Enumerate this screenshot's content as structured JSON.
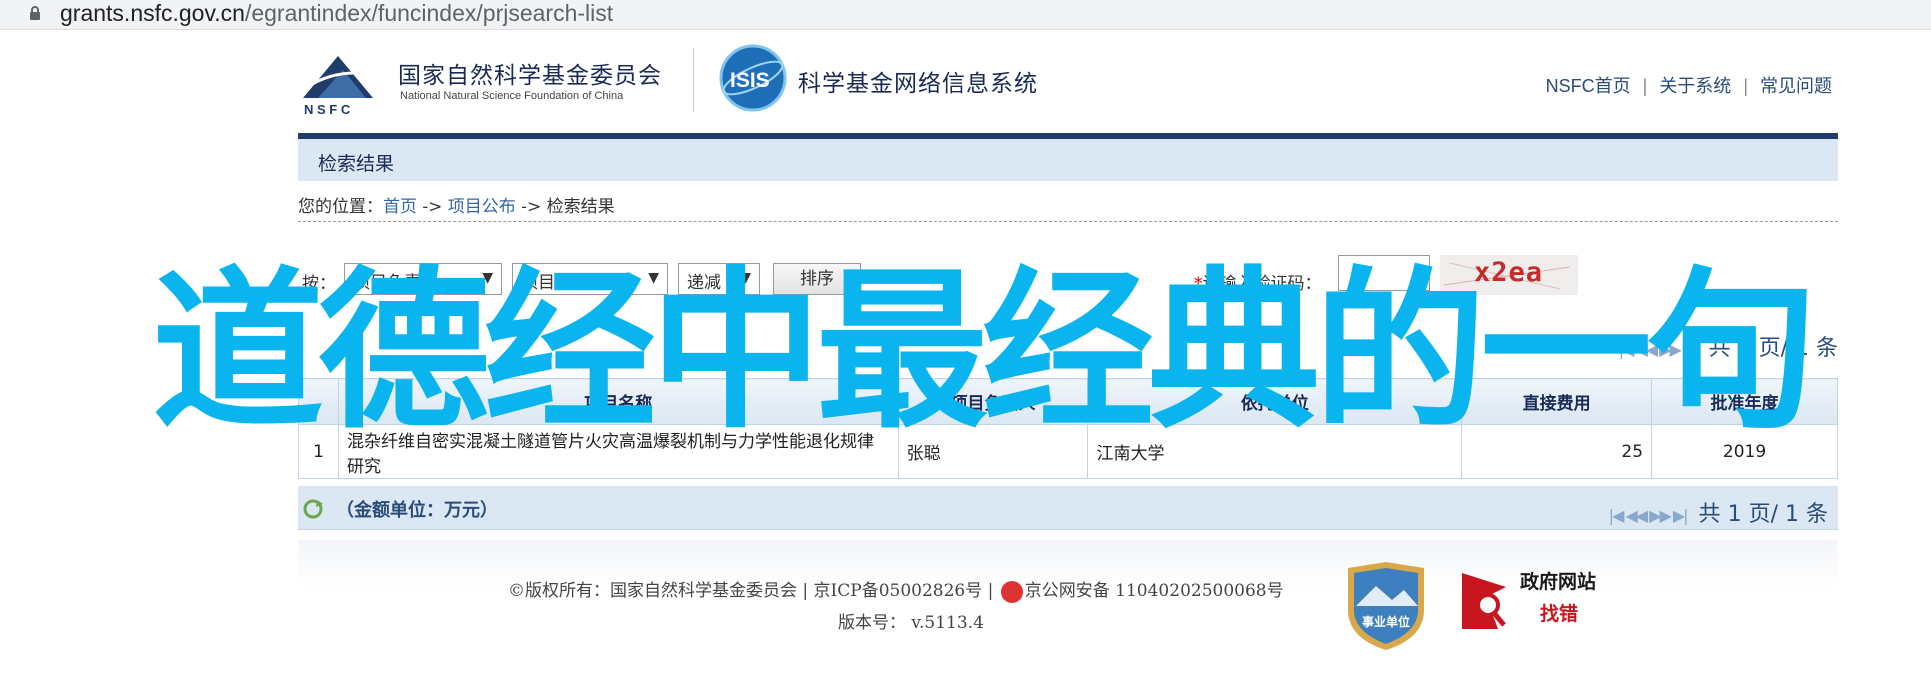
{
  "browser": {
    "url_host": "grants.nsfc.gov.cn",
    "url_path": "/egrantindex/funcindex/prjsearch-list"
  },
  "header": {
    "org_cn": "国家自然科学基金委员会",
    "org_en": "National Natural Science Foundation of China",
    "logo_text": "N S F C",
    "isis_text": "ISIS",
    "system_title": "科学基金网络信息系统",
    "nav": [
      "NSFC首页",
      "关于系统",
      "常见问题"
    ],
    "nav_sep": "|"
  },
  "section_title": "检索结果",
  "breadcrumb": {
    "prefix": "您的位置：",
    "items": [
      "首页",
      "项目公布",
      "检索结果"
    ],
    "sep": " -> "
  },
  "sort": {
    "label": "按：",
    "field1": "项目负责人",
    "field2": "项目名称",
    "order": "递减",
    "sort_button": "排序",
    "captcha_label": "请输入验证码：",
    "required_mark": "*",
    "captcha_text": "x2ea"
  },
  "pager": {
    "prefix": "共",
    "current": "1",
    "unit": "页/",
    "total": "1",
    "total_unit": "条"
  },
  "table": {
    "columns": [
      "",
      "项目名称",
      "项目负责人",
      "依托单位",
      "直接费用",
      "批准年度"
    ],
    "rows": [
      {
        "index": "1",
        "title": "混杂纤维自密实混凝土隧道管片火灾高温爆裂机制与力学性能退化规律研究",
        "leader": "张聪",
        "unit": "江南大学",
        "cost": "25",
        "year": "2019"
      }
    ]
  },
  "summary_label": "（金额单位：万元）",
  "footer": {
    "copyright": "©版权所有：国家自然科学基金委员会 | 京ICP备05002826号 | ",
    "police": "京公网安备 11040202500068号",
    "version_label": "版本号：",
    "version": "v.5113.4",
    "shield_text": "事业单位",
    "gov_line1": "政府网站",
    "gov_line2": "找错"
  },
  "overlay_text": "道德经中最经典的一句",
  "colors": {
    "brand_dark": "#1f3c6a",
    "header_light": "#dbe7f3",
    "link": "#3565a6",
    "overlay": "#0ab4ee",
    "captcha": "#c72a2a"
  }
}
